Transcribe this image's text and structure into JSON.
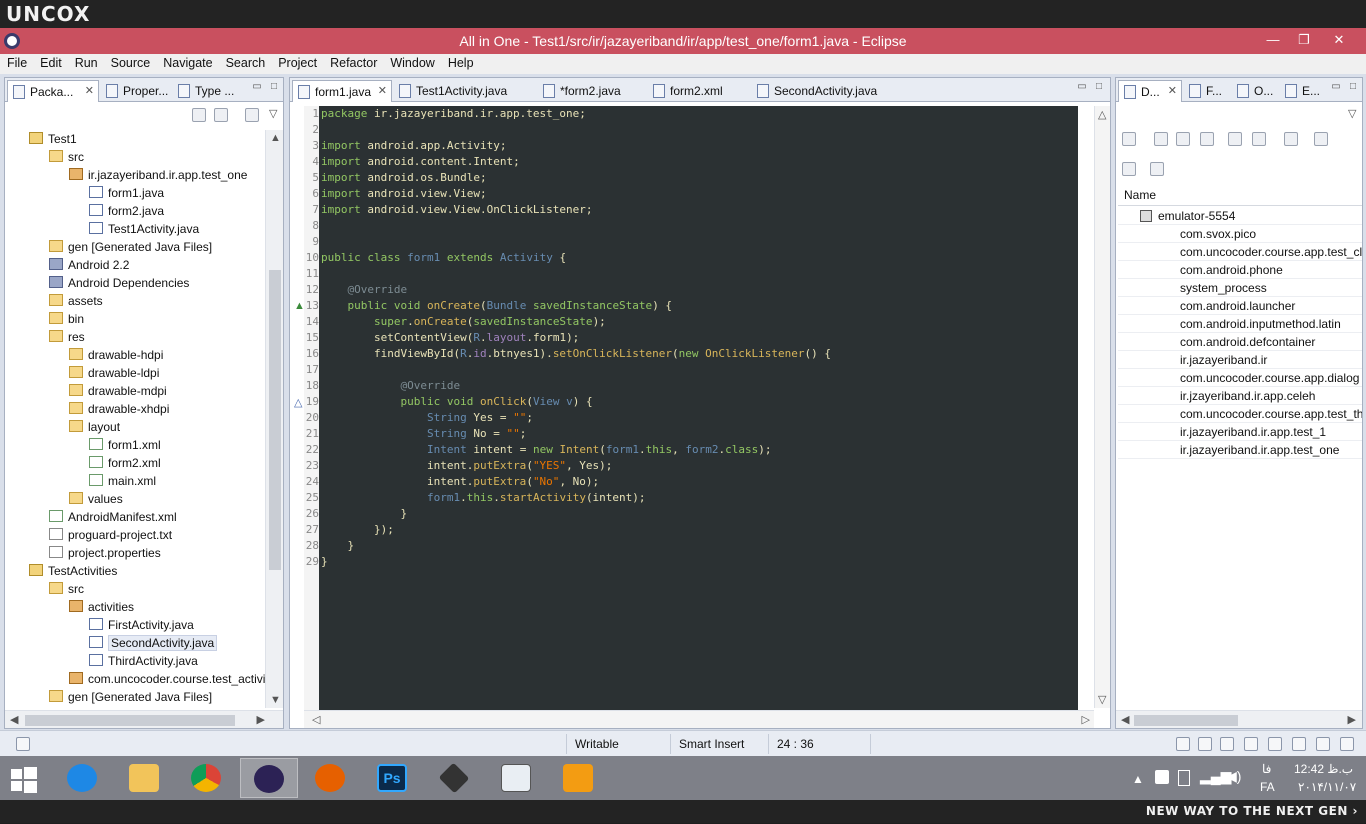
{
  "brand": {
    "logo": "UNCOX",
    "slogan": "NEW WAY TO THE NEXT GEN ›"
  },
  "window": {
    "title": "All in One - Test1/src/ir/jazayeriband/ir/app/test_one/form1.java - Eclipse",
    "min": "—",
    "max": "❐",
    "close": "✕"
  },
  "menu": [
    "File",
    "Edit",
    "Run",
    "Source",
    "Navigate",
    "Search",
    "Project",
    "Refactor",
    "Window",
    "Help"
  ],
  "left_tabs": [
    "Packa...",
    "Proper...",
    "Type ..."
  ],
  "tree": [
    {
      "label": "Test1",
      "icon": "project"
    },
    {
      "label": "src",
      "icon": "folder"
    },
    {
      "label": "ir.jazayeriband.ir.app.test_one",
      "icon": "pkg"
    },
    {
      "label": "form1.java",
      "icon": "java"
    },
    {
      "label": "form2.java",
      "icon": "java"
    },
    {
      "label": "Test1Activity.java",
      "icon": "java"
    },
    {
      "label": "gen [Generated Java Files]",
      "icon": "folder"
    },
    {
      "label": "Android 2.2",
      "icon": "lib"
    },
    {
      "label": "Android Dependencies",
      "icon": "lib"
    },
    {
      "label": "assets",
      "icon": "folder"
    },
    {
      "label": "bin",
      "icon": "folder"
    },
    {
      "label": "res",
      "icon": "folder"
    },
    {
      "label": "drawable-hdpi",
      "icon": "folder"
    },
    {
      "label": "drawable-ldpi",
      "icon": "folder"
    },
    {
      "label": "drawable-mdpi",
      "icon": "folder"
    },
    {
      "label": "drawable-xhdpi",
      "icon": "folder"
    },
    {
      "label": "layout",
      "icon": "folder"
    },
    {
      "label": "form1.xml",
      "icon": "xml"
    },
    {
      "label": "form2.xml",
      "icon": "xml"
    },
    {
      "label": "main.xml",
      "icon": "xml"
    },
    {
      "label": "values",
      "icon": "folder"
    },
    {
      "label": "AndroidManifest.xml",
      "icon": "xml"
    },
    {
      "label": "proguard-project.txt",
      "icon": "txt"
    },
    {
      "label": "project.properties",
      "icon": "txt"
    },
    {
      "label": "TestActivities",
      "icon": "project"
    },
    {
      "label": "src",
      "icon": "folder"
    },
    {
      "label": "activities",
      "icon": "pkg"
    },
    {
      "label": "FirstActivity.java",
      "icon": "java"
    },
    {
      "label": "SecondActivity.java",
      "icon": "java"
    },
    {
      "label": "ThirdActivity.java",
      "icon": "java"
    },
    {
      "label": "com.uncocoder.course.test_activi",
      "icon": "pkg"
    },
    {
      "label": "gen [Generated Java Files]",
      "icon": "folder"
    }
  ],
  "editor_tabs": [
    "form1.java",
    "Test1Activity.java",
    "*form2.java",
    "form2.xml",
    "SecondActivity.java"
  ],
  "code_lines": [
    "package ir.jazayeriband.ir.app.test_one;",
    "",
    "import android.app.Activity;",
    "import android.content.Intent;",
    "import android.os.Bundle;",
    "import android.view.View;",
    "import android.view.View.OnClickListener;",
    "",
    "",
    "public class form1 extends Activity {",
    "",
    "    @Override",
    "    public void onCreate(Bundle savedInstanceState) {",
    "        super.onCreate(savedInstanceState);",
    "        setContentView(R.layout.form1);",
    "        findViewById(R.id.btnyes1).setOnClickListener(new OnClickListener() {",
    "",
    "            @Override",
    "            public void onClick(View v) {",
    "                String Yes = \"\";",
    "                String No = \"\";",
    "                Intent intent = new Intent(form1.this, form2.class);",
    "                intent.putExtra(\"YES\", Yes);",
    "                intent.putExtra(\"No\", No);",
    "                form1.this.startActivity(intent);",
    "            }",
    "        });",
    "    }",
    "}"
  ],
  "right_tabs": [
    "D...",
    "F...",
    "O...",
    "E..."
  ],
  "devices": {
    "header": "Name",
    "emulator": "emulator-5554",
    "processes": [
      "com.svox.pico",
      "com.uncocoder.course.app.test_cl",
      "com.android.phone",
      "system_process",
      "com.android.launcher",
      "com.android.inputmethod.latin",
      "com.android.defcontainer",
      "ir.jazayeriband.ir",
      "com.uncocoder.course.app.dialog",
      "ir.jzayeriband.ir.app.celeh",
      "com.uncocoder.course.app.test_th",
      "ir.jazayeriband.ir.app.test_1",
      "ir.jazayeriband.ir.app.test_one"
    ]
  },
  "status": {
    "mode": "Writable",
    "insert": "Smart Insert",
    "position": "24 : 36"
  },
  "taskbar": {
    "apps": [
      "start",
      "internet-explorer",
      "file-explorer",
      "chrome",
      "eclipse",
      "firefox",
      "photoshop",
      "app-7",
      "app-8",
      "media-player"
    ],
    "lang_top": "فا",
    "lang_bottom": "FA",
    "time": "12:42 ب.ظ",
    "date": "۲۰۱۴/۱۱/۰۷"
  },
  "colors": {
    "title_bar": "#c9505f",
    "editor_bg": "#2b3133",
    "keyword": "#93c763"
  }
}
